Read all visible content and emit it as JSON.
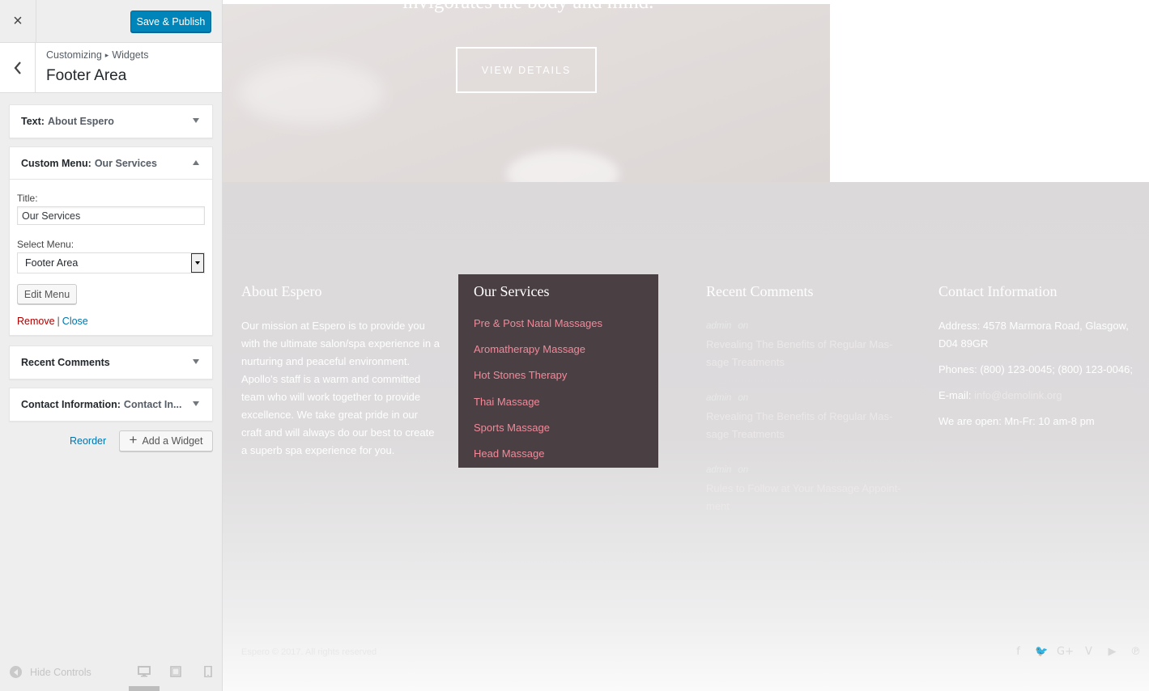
{
  "customizer": {
    "close_icon": "×",
    "save_label": "Save & Publish",
    "breadcrumb": {
      "parent": "Customizing",
      "separator": "▸",
      "current": "Widgets"
    },
    "section_title": "Footer Area",
    "widgets": {
      "text": {
        "type": "Text:",
        "title": "About Espero"
      },
      "menu": {
        "type": "Custom Menu:",
        "title": "Our Services",
        "title_label": "Title:",
        "title_value": "Our Services",
        "select_label": "Select Menu:",
        "select_value": "Footer Area",
        "edit_label": "Edit Menu",
        "remove_label": "Remove",
        "sep": "|",
        "close_label": "Close"
      },
      "comments": {
        "type": "Recent Comments"
      },
      "contact": {
        "type": "Contact Information:",
        "title": "Contact In..."
      }
    },
    "reorder_label": "Reorder",
    "add_widget_label": "Add a Widget",
    "hide_controls_label": "Hide Controls"
  },
  "preview": {
    "hero_heading": "invigorates the body and mind.",
    "view_details": "VIEW DETAILS",
    "about": {
      "title": "About Espero",
      "text": "Our mission at Espero is to provide you with the ultimate salon/spa experience in a nurturing and peaceful environment. Apollo's staff is a warm and committed team who will work together to provide excellence. We take great pride in our craft and will always do our best to create a superb spa experience for you."
    },
    "services": {
      "title": "Our Services",
      "items": [
        "Pre & Post Natal Massages",
        "Aromatherapy Massage",
        "Hot Stones Therapy",
        "Thai Massage",
        "Sports Massage",
        "Head Massage"
      ]
    },
    "recent_comments": {
      "title": "Recent Comments",
      "items": [
        {
          "author": "admin",
          "on": "on",
          "post": "Revealing The Benefits of Regular Mas- sage Treatments"
        },
        {
          "author": "admin",
          "on": "on",
          "post": "Revealing The Benefits of Regular Mas- sage Treatments"
        },
        {
          "author": "admin",
          "on": "on",
          "post": "Rules to Follow at Your Massage Appoint- ment"
        }
      ]
    },
    "contact": {
      "title": "Contact Information",
      "address": "Address: 4578 Marmora Road, Glasgow, D04 89GR",
      "phones": "Phones: (800) 123-0045; (800) 123-0046;",
      "email_label": "E-mail:",
      "email": "info@demolink.org",
      "hours": "We are open: Mn-Fr: 10 am-8 pm"
    },
    "copyright": "Espero © 2017. All rights reserved",
    "social_icons": [
      "facebook-icon",
      "twitter-icon",
      "google-plus-icon",
      "vimeo-icon",
      "youtube-icon",
      "pinterest-icon"
    ],
    "social_glyphs": [
      "f",
      "🐦",
      "G+",
      "V",
      "▶",
      "℗"
    ]
  },
  "colors": {
    "save_button": "#0085ba",
    "services_box": "#4a3f43",
    "services_link": "#f08a9a",
    "link_blue": "#0073aa",
    "remove_red": "#aa0000"
  }
}
